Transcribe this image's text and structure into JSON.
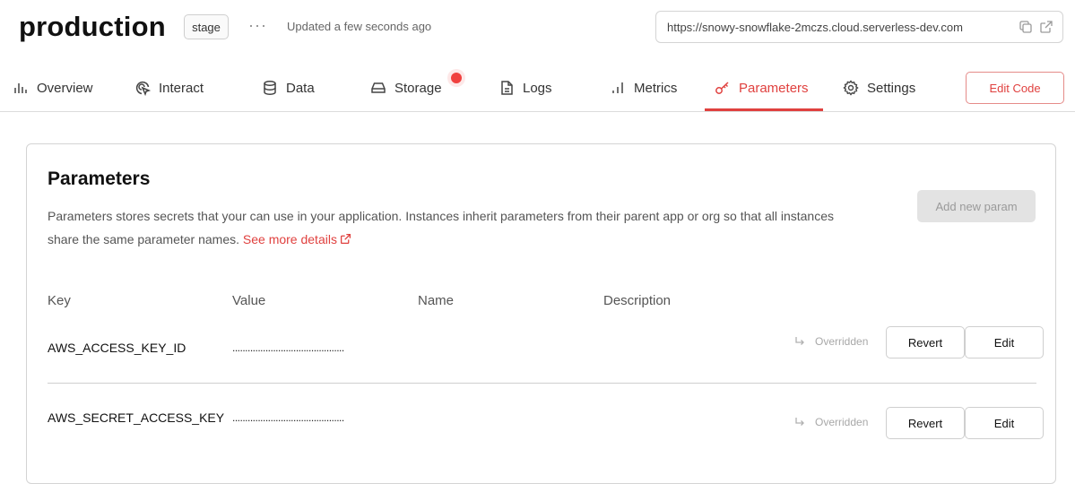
{
  "header": {
    "title": "production",
    "stage": "stage",
    "more": "···",
    "updated": "Updated a few seconds ago",
    "url": "https://snowy-snowflake-2mczs.cloud.serverless-dev.com"
  },
  "tabs": [
    {
      "label": "Overview",
      "icon": "chart-icon"
    },
    {
      "label": "Interact",
      "icon": "cursor-click-icon"
    },
    {
      "label": "Data",
      "icon": "database-icon"
    },
    {
      "label": "Storage",
      "icon": "drive-icon"
    },
    {
      "label": "Logs",
      "icon": "document-icon"
    },
    {
      "label": "Metrics",
      "icon": "bars-icon"
    },
    {
      "label": "Parameters",
      "icon": "key-icon"
    },
    {
      "label": "Settings",
      "icon": "gear-icon"
    }
  ],
  "active_tab": "Parameters",
  "edit_code": "Edit Code",
  "parameters": {
    "title": "Parameters",
    "description": "Parameters stores secrets that your can use in your application. Instances inherit parameters from their parent app or org so that all instances share the same parameter names.",
    "link": "See more details",
    "add_button": "Add new param",
    "columns": [
      "Key",
      "Value",
      "Name",
      "Description"
    ],
    "rows": [
      {
        "key": "AWS_ACCESS_KEY_ID",
        "value": "............................................",
        "name": "",
        "description": "",
        "status": "Overridden",
        "revert": "Revert",
        "edit": "Edit"
      },
      {
        "key": "AWS_SECRET_ACCESS_KEY",
        "value": "............................................",
        "name": "",
        "description": "",
        "status": "Overridden",
        "revert": "Revert",
        "edit": "Edit"
      }
    ]
  },
  "colors": {
    "accent": "#e0413f",
    "border": "#d4d4d4",
    "muted_text": "#555555",
    "disabled_bg": "#e3e3e3"
  }
}
